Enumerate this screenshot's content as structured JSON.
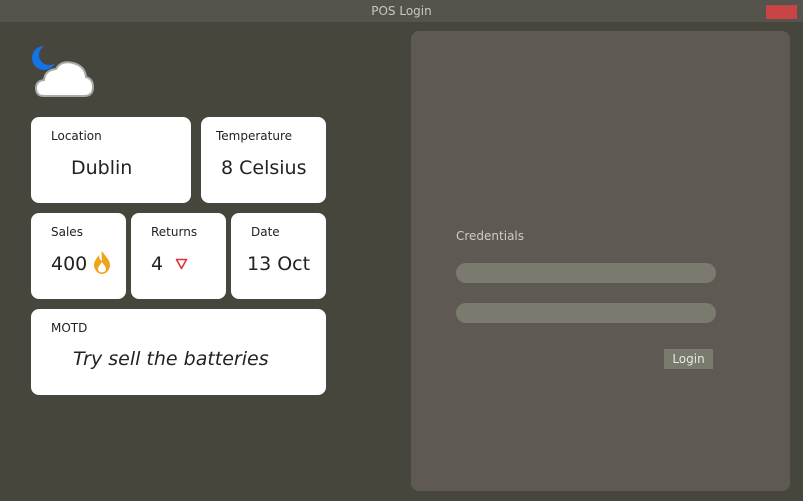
{
  "window": {
    "title": "POS Login"
  },
  "weather": {
    "icon": "night-cloudy-icon"
  },
  "cards": {
    "location": {
      "label": "Location",
      "value": "Dublin"
    },
    "temperature": {
      "label": "Temperature",
      "value": "8 Celsius"
    },
    "sales": {
      "label": "Sales",
      "value": "400",
      "icon": "flame-icon"
    },
    "returns": {
      "label": "Returns",
      "value": "4",
      "icon": "triangle-down-icon"
    },
    "date": {
      "label": "Date",
      "value": "13 Oct"
    },
    "motd": {
      "label": "MOTD",
      "value": "Try sell the batteries"
    }
  },
  "login": {
    "credentials_label": "Credentials",
    "username_value": "",
    "password_value": "",
    "button_label": "Login"
  },
  "colors": {
    "window_bg": "#47463c",
    "panel_bg": "#5e5a53",
    "card_bg": "#ffffff",
    "close": "#c94545",
    "flame": "#f0a31a",
    "returns_arrow": "#e0303a",
    "moon": "#1473e6"
  }
}
